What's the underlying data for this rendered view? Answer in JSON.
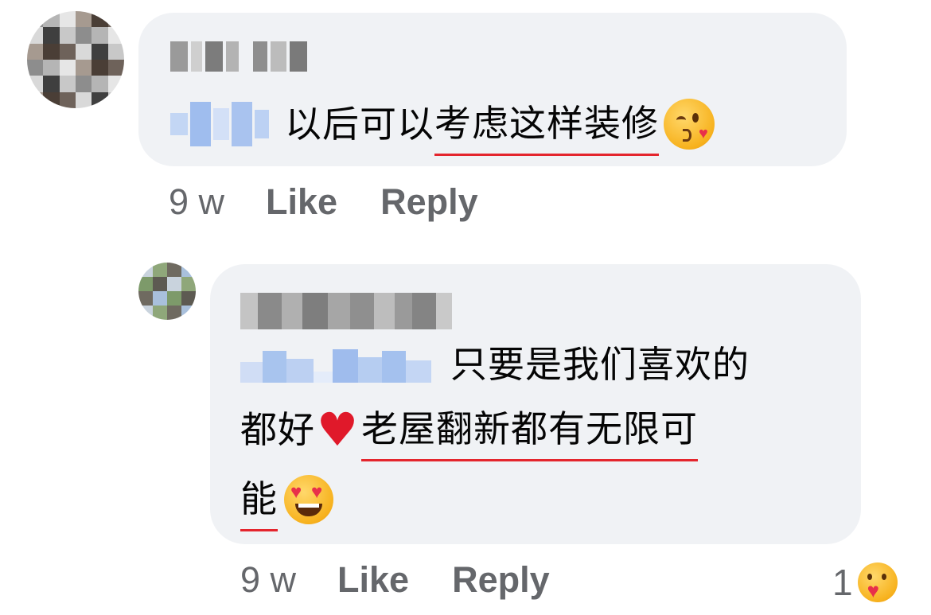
{
  "comments": [
    {
      "text_plain": "以后可以",
      "text_underlined": "考虑这样装修",
      "emoji": "kissing-face-with-heart-emoji",
      "timestamp": "9 w",
      "like_label": "Like",
      "reply_label": "Reply"
    },
    {
      "line1": "只要是我们喜欢的",
      "line2_plain": "都好",
      "line2_underlined": "老屋翻新都有无限可",
      "line3_underlined": "能",
      "emoji_heart": "red-heart-emoji",
      "emoji_end": "heart-eyes-emoji",
      "timestamp": "9 w",
      "like_label": "Like",
      "reply_label": "Reply",
      "reaction_count": "1",
      "reaction_icon": "care-reaction-icon"
    }
  ],
  "colors": {
    "bubble": "#f0f2f5",
    "underline": "#e4252d",
    "muted_text": "#65676b",
    "mention_blur": "#a8c4ee"
  }
}
